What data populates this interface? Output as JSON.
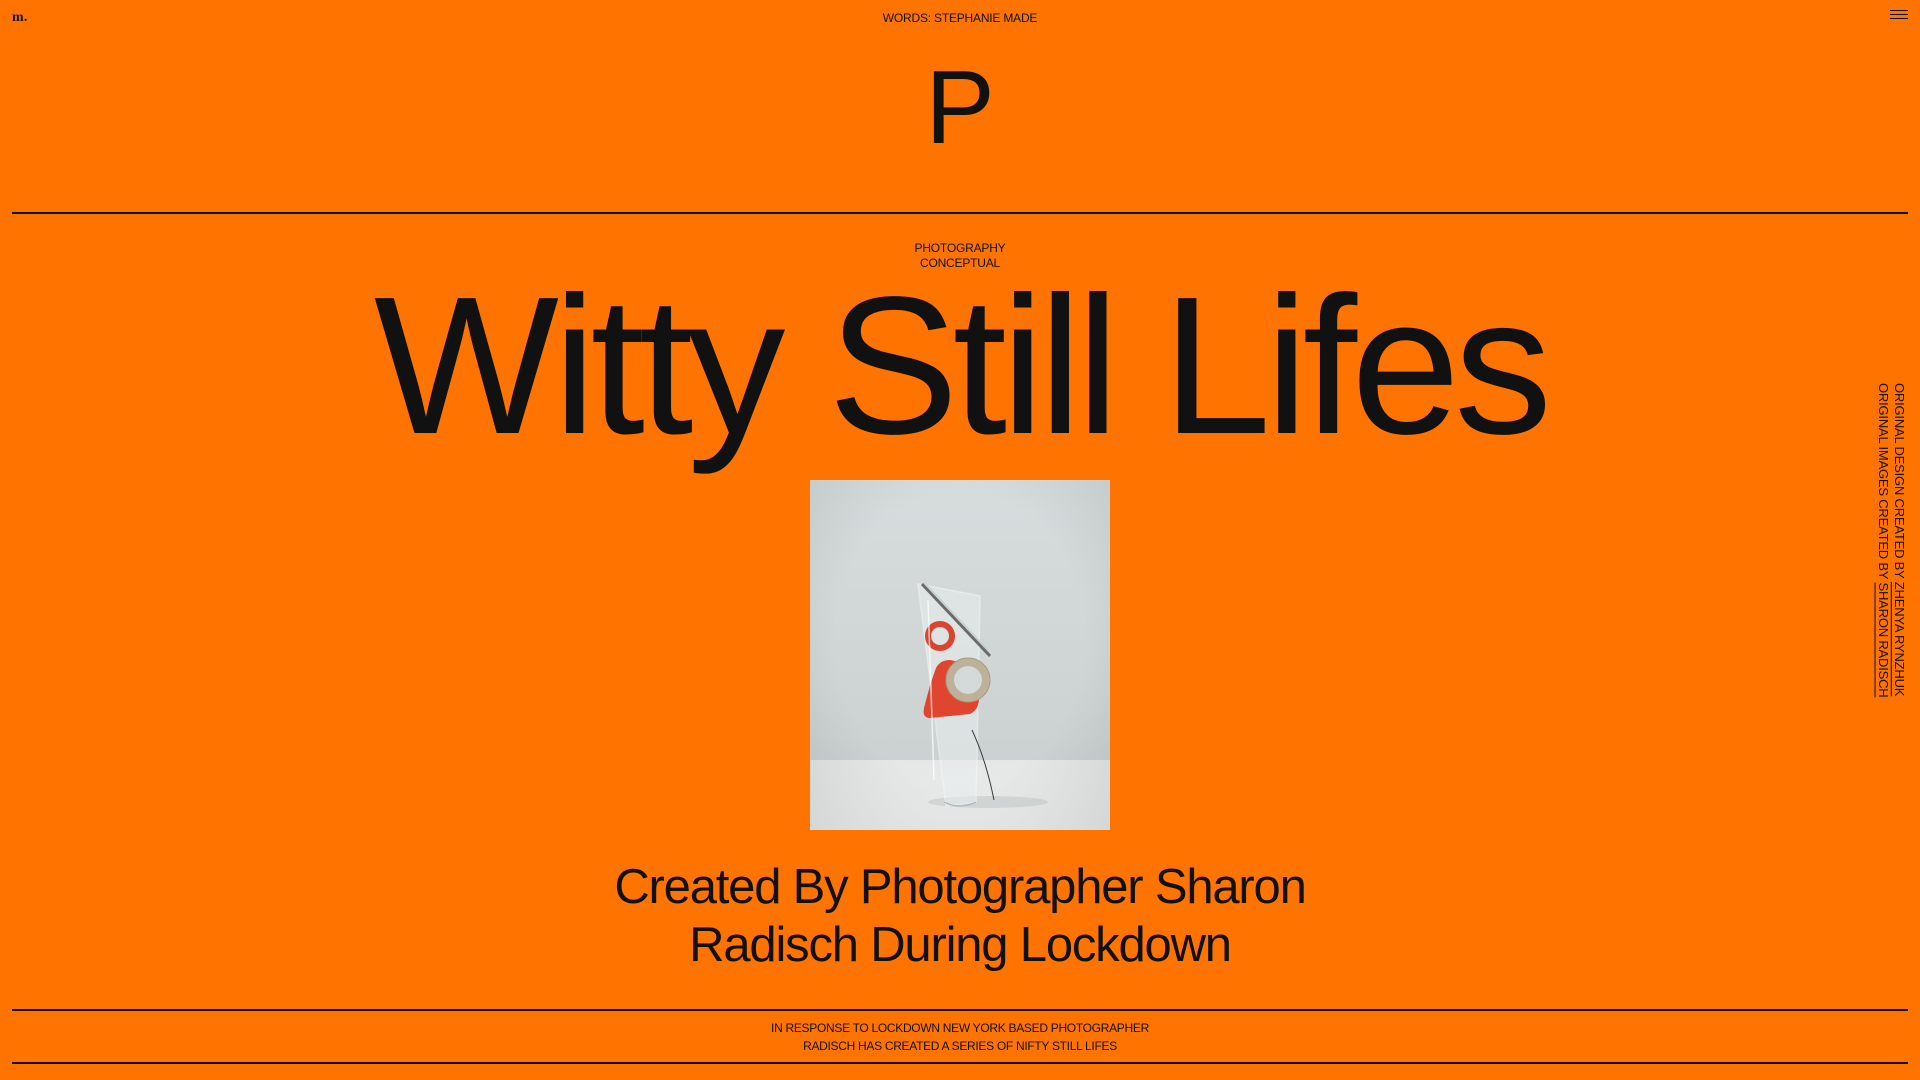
{
  "header": {
    "logo": "m.",
    "credit": "WORDS: STEPHANIE MADE",
    "menu_icon": "hamburger-menu-icon"
  },
  "section_letter": "P",
  "tags": [
    "PHOTOGRAPHY",
    "CONCEPTUAL"
  ],
  "headline": "Witty Still Lifes",
  "hero_image": {
    "subject": "tape-dispenser-in-glass"
  },
  "subtitle": {
    "line1": "Created By Photographer Sharon",
    "line2": "Radisch During Lockdown"
  },
  "footer": {
    "line1": "IN RESPONSE TO LOCKDOWN NEW YORK BASED PHOTOGRAPHER",
    "line2": "RADISCH HAS CREATED A SERIES OF NIFTY STILL LIFES"
  },
  "side_credits": {
    "design_prefix": "ORIGINAL DESIGN CREATED BY ",
    "design_name": "ZHENYA RYNZHUK",
    "images_prefix": "ORIGINAL IMAGES CREATED BY ",
    "images_name": "SHARON RADISCH"
  },
  "colors": {
    "background": "#FF7300",
    "text": "#111111"
  }
}
